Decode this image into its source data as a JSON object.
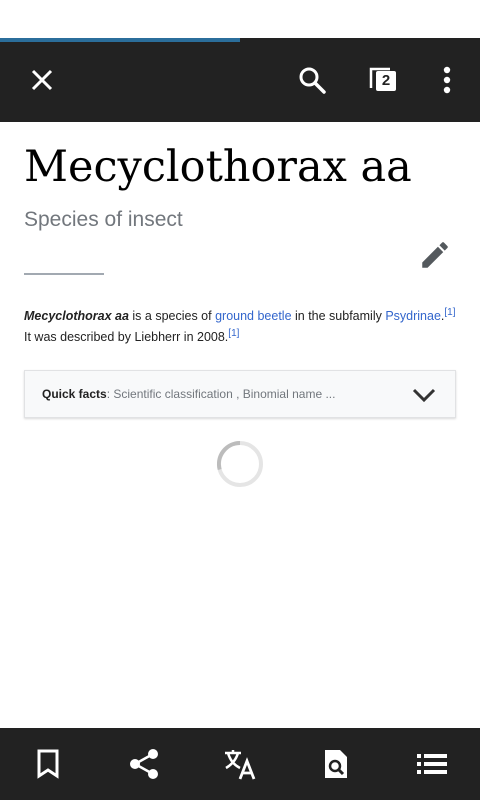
{
  "page_load_progress": 0.5,
  "toolbar": {
    "close_icon": "close-icon",
    "search_icon": "search-icon",
    "tabs_icon": "tabs-icon",
    "tabs_count": "2",
    "menu_icon": "overflow-menu-icon"
  },
  "article": {
    "title": "Mecyclothorax aa",
    "description": "Species of insect",
    "edit_icon": "pencil-icon",
    "lead": {
      "subject": "Mecyclothorax aa",
      "t1": " is a species of ",
      "link1": "ground beetle",
      "t2": " in the subfamily ",
      "link2": "Psydrinae",
      "t3": ".",
      "ref1": "[1]",
      "t4": " It was described by Liebherr in 2008.",
      "ref2": "[1]"
    }
  },
  "quick_facts": {
    "label": "Quick facts",
    "summary": ": Scientific classification , Binomial name ..."
  },
  "bottom_bar": {
    "icons": [
      "bookmark-icon",
      "share-icon",
      "translate-icon",
      "find-in-page-icon",
      "table-of-contents-icon"
    ]
  },
  "colors": {
    "toolbar": "#222222",
    "progress": "#2b6e9b",
    "link": "#3366cc"
  }
}
